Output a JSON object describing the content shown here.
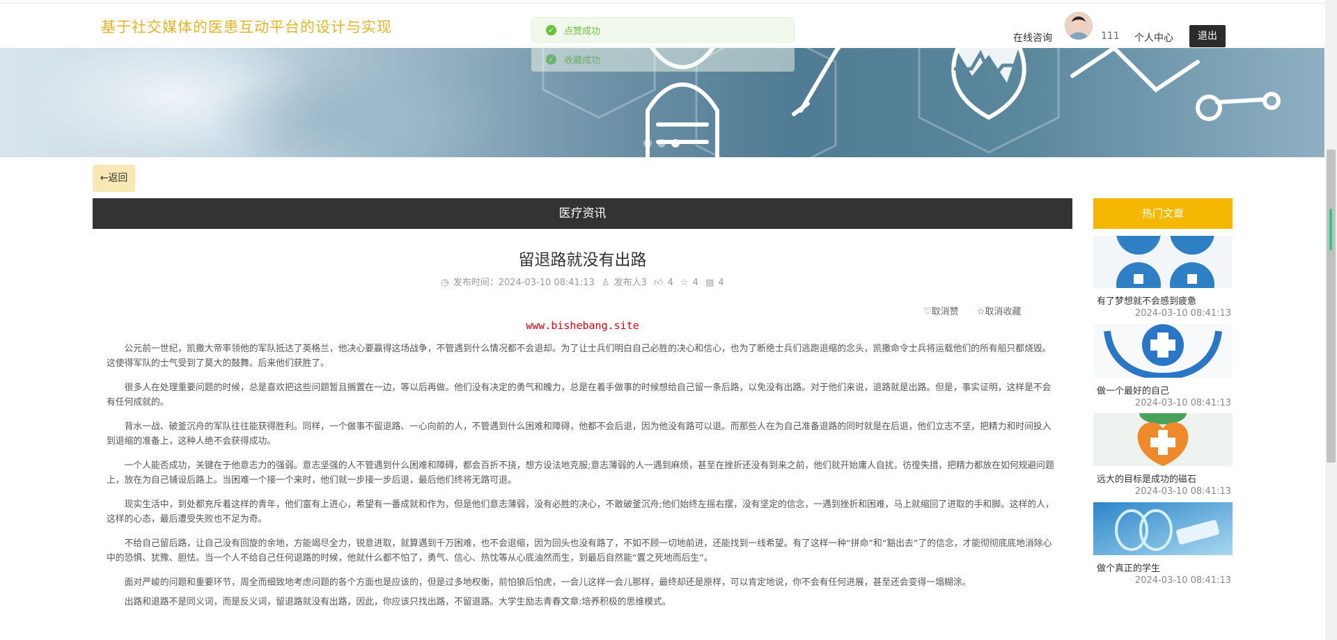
{
  "header": {
    "site_title": "基于社交媒体的医患互动平台的设计与实现",
    "consult_label": "在线咨询",
    "username": "111",
    "personal_center_label": "个人中心",
    "logout_label": "退出"
  },
  "toasts": [
    {
      "text": "点赞成功"
    },
    {
      "text": "收藏成功"
    }
  ],
  "back_label": "←返回",
  "section_title": "医疗资讯",
  "article": {
    "title": "留退路就没有出路",
    "publish_time": "发布时间：2024-03-10 08:41:13",
    "publisher": "发布人3",
    "likes": "4",
    "favorites": "4",
    "comments": "4",
    "unlike_label": "取消赞",
    "unfavorite_label": "取消收藏",
    "watermark": "www.bishebang.site",
    "paragraphs": [
      "公元前一世纪，凯撒大帝率领他的军队抵达了英格兰，他决心要赢得这场战争，不管遇到什么情况都不会退却。为了让士兵们明白自己必胜的决心和信心，也为了断绝士兵们逃跑退缩的念头，凯撒命令士兵将运载他们的所有船只都烧毁。这使得军队的士气受到了莫大的鼓舞。后来他们获胜了。",
      "很多人在处理重要问题的时候，总是喜欢把这些问题暂且搁置在一边，等以后再做。他们没有决定的勇气和魄力，总是在着手做事的时候想给自己留一条后路，以免没有出路。对于他们来说，退路就是出路。但是，事实证明，这样是不会有任何成就的。",
      "背水一战、破釜沉舟的军队往往能获得胜利。同样，一个做事不留退路、一心向前的人，不管遇到什么困难和障碍，他都不会后退，因为他没有路可以退。而那些人在为自己准备退路的同时就是在后退，他们立志不坚，把精力和时间投入到退缩的准备上，这种人绝不会获得成功。",
      "一个人能否成功，关键在于他意志力的强弱。意志坚强的人不管遇到什么困难和障碍，都会百折不挠，想方设法地克服;意志薄弱的人一遇到麻烦，甚至在挫折还没有到来之前，他们就开始庸人自扰，彷徨失措，把精力都放在如何规避问题上，放在为自己铺设后路上。当困难一个接一个来时，他们就一步接一步后退，最后他们终将无路可退。",
      "现实生活中，到处都充斥着这样的青年，他们富有上进心，希望有一番成就和作为，但是他们意志薄弱，没有必胜的决心，不敢破釜沉舟;他们始终左摇右摆，没有坚定的信念，一遇到挫折和困难，马上就缩回了进取的手和脚。这样的人，这样的心态，最后遭受失败也不足为奇。",
      "不给自己留后路，让自己没有回旋的余地，方能竭尽全力，锐意进取，就算遇到千万困难，也不会退缩，因为回头也没有路了，不如不顾一切地前进，还能找到一线希望。有了这样一种“拼命”和“豁出去”了的信念，才能彻彻底底地消除心中的恐惧、犹豫、胆怯。当一个人不给自己任何退路的时候，他就什么都不怕了，勇气、信心、热忱等从心底油然而生，到最后自然能“置之死地而后生”。",
      "面对严峻的问题和重要环节，周全而细致地考虑问题的各个方面也是应该的，但是过多地权衡，前怕狼后怕虎，一会儿这样一会儿那样，最终却还是原样，可以肯定地说，你不会有任何进展，甚至还会变得一塌糊涂。",
      "出路和退路不是同义词，而是反义词，留退路就没有出路，因此，你应该只找出路，不留退路。大学生励志青春文章:培养积极的思维模式。"
    ]
  },
  "sidebar": {
    "title": "热门文章",
    "items": [
      {
        "name": "有了梦想就不会感到疲惫",
        "time": "2024-03-10 08:41:13"
      },
      {
        "name": "做一个最好的自己",
        "time": "2024-03-10 08:41:13"
      },
      {
        "name": "远大的目标是成功的磁石",
        "time": "2024-03-10 08:41:13"
      },
      {
        "name": "做个真正的学生",
        "time": "2024-03-10 08:41:13"
      }
    ]
  },
  "carousel": {
    "slides": 3,
    "active_index": 2
  }
}
